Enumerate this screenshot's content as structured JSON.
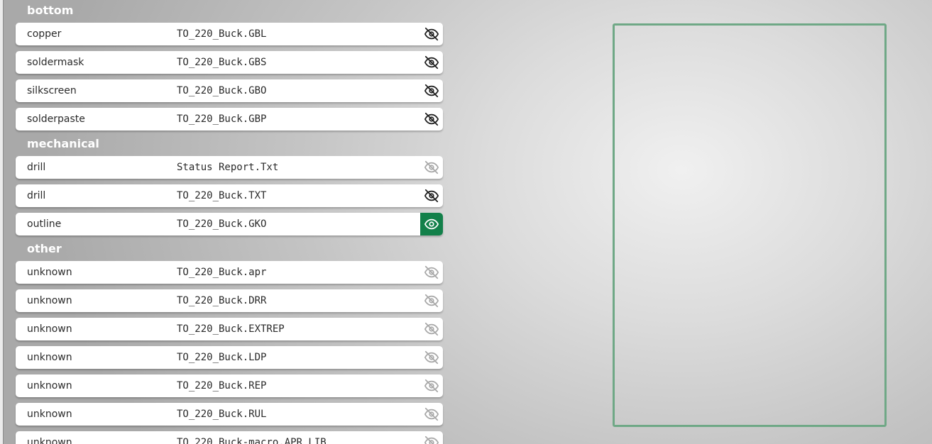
{
  "groups": [
    {
      "title": "bottom",
      "layers": [
        {
          "type": "copper",
          "file": "TO_220_Buck.GBL",
          "visibility": "hidden"
        },
        {
          "type": "soldermask",
          "file": "TO_220_Buck.GBS",
          "visibility": "hidden"
        },
        {
          "type": "silkscreen",
          "file": "TO_220_Buck.GBO",
          "visibility": "hidden"
        },
        {
          "type": "solderpaste",
          "file": "TO_220_Buck.GBP",
          "visibility": "hidden"
        }
      ]
    },
    {
      "title": "mechanical",
      "layers": [
        {
          "type": "drill",
          "file": "Status Report.Txt",
          "visibility": "disabled"
        },
        {
          "type": "drill",
          "file": "TO_220_Buck.TXT",
          "visibility": "hidden"
        },
        {
          "type": "outline",
          "file": "TO_220_Buck.GKO",
          "visibility": "visible"
        }
      ]
    },
    {
      "title": "other",
      "layers": [
        {
          "type": "unknown",
          "file": "TO_220_Buck.apr",
          "visibility": "disabled"
        },
        {
          "type": "unknown",
          "file": "TO_220_Buck.DRR",
          "visibility": "disabled"
        },
        {
          "type": "unknown",
          "file": "TO_220_Buck.EXTREP",
          "visibility": "disabled"
        },
        {
          "type": "unknown",
          "file": "TO_220_Buck.LDP",
          "visibility": "disabled"
        },
        {
          "type": "unknown",
          "file": "TO_220_Buck.REP",
          "visibility": "disabled"
        },
        {
          "type": "unknown",
          "file": "TO_220_Buck.RUL",
          "visibility": "disabled"
        },
        {
          "type": "unknown",
          "file": "TO_220_Buck-macro.APR_LIB",
          "visibility": "disabled"
        }
      ]
    }
  ],
  "icons": {
    "visible": "eye-icon",
    "hidden": "eye-slash-icon",
    "disabled": "eye-slash-icon"
  },
  "colors": {
    "visible_toggle_bg": "#13804a",
    "board_outline": "#6fa886",
    "group_header_text": "#ffffff"
  }
}
